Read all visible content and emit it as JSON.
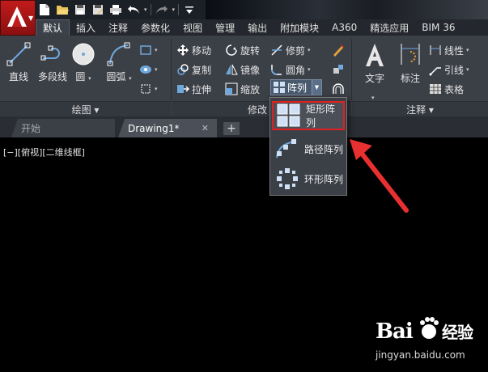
{
  "quick_access": {
    "icons": [
      "new-icon",
      "open-icon",
      "save-icon",
      "save-as-icon",
      "print-icon",
      "undo-icon",
      "redo-icon",
      "customize-icon"
    ]
  },
  "ribbon_tabs": [
    "默认",
    "插入",
    "注释",
    "参数化",
    "视图",
    "管理",
    "输出",
    "附加模块",
    "A360",
    "精选应用",
    "BIM 36"
  ],
  "draw_panel": {
    "tools": [
      "直线",
      "多段线",
      "圆",
      "圆弧"
    ],
    "footer": "绘图 ▾"
  },
  "modify_panel": {
    "row1": [
      "移动",
      "旋转",
      "修剪"
    ],
    "row2": [
      "复制",
      "镜像",
      "圆角"
    ],
    "row3": [
      "拉伸",
      "缩放",
      "阵列"
    ],
    "footer": "修改"
  },
  "annotation_panel": {
    "big_tools": [
      "文字",
      "标注"
    ],
    "small_tools": [
      "线性",
      "引线",
      "表格"
    ],
    "footer": "注释 ▾"
  },
  "file_tabs": {
    "start": "开始",
    "drawing": "Drawing1*",
    "close": "✕",
    "new": "+"
  },
  "viewport": {
    "label": "[−][俯视][二维线框]"
  },
  "array_dropdown": {
    "items": [
      "矩形阵列",
      "路径阵列",
      "环形阵列"
    ],
    "selected": "矩形阵列"
  },
  "watermark": {
    "url": "jingyan.baidu.com"
  },
  "colors": {
    "app_button": "#c21b1b",
    "ribbon": "#3b3f46",
    "highlight": "#e02020",
    "icon_blue": "#6fa8dc"
  }
}
